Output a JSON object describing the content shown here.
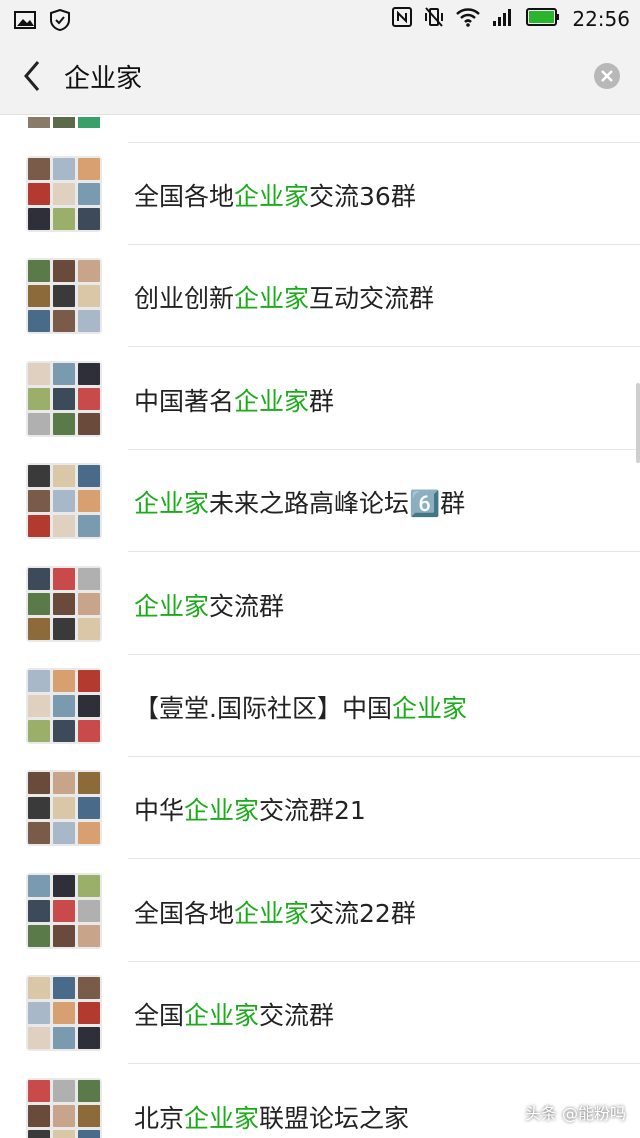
{
  "status_bar": {
    "time": "22:56",
    "icons": [
      "gallery-icon",
      "shield-icon",
      "nfc-icon",
      "vibrate-icon",
      "wifi-icon",
      "signal-icon",
      "battery-icon"
    ]
  },
  "header": {
    "search_query": "企业家",
    "back_icon": "chevron-left-icon",
    "clear_icon": "close-circle-icon"
  },
  "highlight_color": "#1aad19",
  "results": [
    {
      "before": "全国各地",
      "match": "企业家",
      "after": "交流36群"
    },
    {
      "before": "创业创新",
      "match": "企业家",
      "after": "互动交流群"
    },
    {
      "before": "中国著名",
      "match": "企业家",
      "after": "群"
    },
    {
      "before": "",
      "match": "企业家",
      "after": "未来之路高峰论坛6️⃣群"
    },
    {
      "before": "",
      "match": "企业家",
      "after": "交流群"
    },
    {
      "before": "【壹堂.国际社区】中国",
      "match": "企业家",
      "after": ""
    },
    {
      "before": "中华",
      "match": "企业家",
      "after": "交流群21"
    },
    {
      "before": "全国各地",
      "match": "企业家",
      "after": "交流22群"
    },
    {
      "before": "全国",
      "match": "企业家",
      "after": "交流群"
    },
    {
      "before": "北京",
      "match": "企业家",
      "after": "联盟论坛之家"
    }
  ],
  "watermark": "头条 @能粉吗"
}
